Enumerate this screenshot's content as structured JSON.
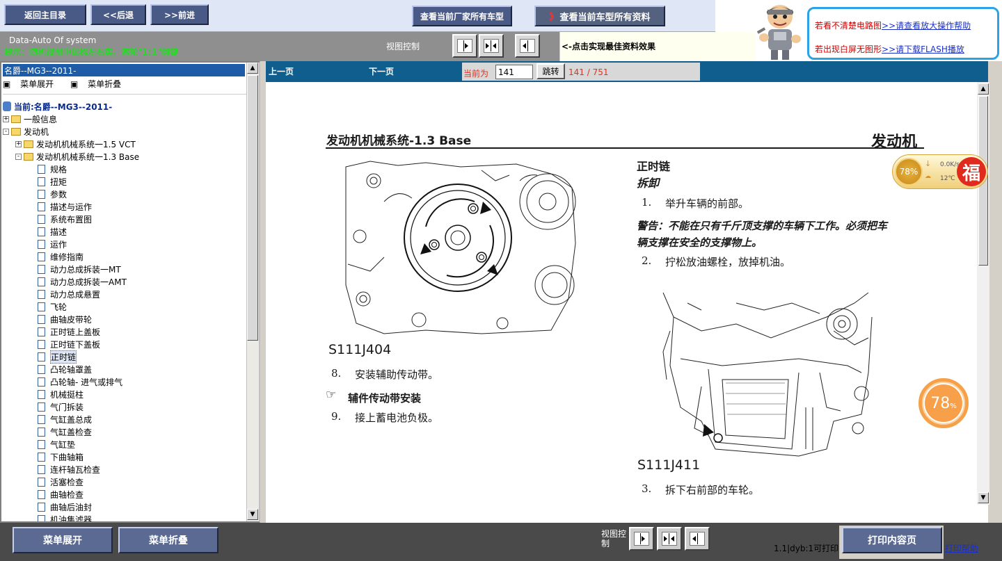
{
  "topbar": {
    "back_main": "返回主目录",
    "back": "<<后退",
    "forward": ">>前进",
    "maker_models": "查看当前厂家所有车型",
    "all_data": "查看当前车型所有资料",
    "all_data_arrow": "》"
  },
  "help": {
    "line1_text": "若看不清楚电路图",
    "line1_link": ">>请查看放大操作帮助",
    "line2_text": "若出现白屏无图形",
    "line2_link": ">>请下载FLASH播放"
  },
  "subbar": {
    "system": "Data-Auto Of system",
    "note": "提示：随机视图中鼠标左右实，滚轮\"1:1\"翻键",
    "view_control": "视图控制",
    "tip": "<-点击实现最佳资料效果"
  },
  "left": {
    "car_title": "名爵--MG3--2011-",
    "expand": "菜单展开",
    "collapse": "菜单折叠",
    "tree": [
      {
        "label": "当前:名爵--MG3--2011-",
        "type": "current",
        "level": 0
      },
      {
        "label": "一般信息",
        "type": "folder",
        "sign": "+",
        "level": 0
      },
      {
        "label": "发动机",
        "type": "folder",
        "sign": "-",
        "level": 0
      },
      {
        "label": "发动机机械系统一1.5 VCT",
        "type": "folder",
        "sign": "+",
        "level": 1
      },
      {
        "label": "发动机机械系统一1.3 Base",
        "type": "folder",
        "sign": "-",
        "level": 1
      },
      {
        "label": "规格",
        "type": "doc",
        "level": 2
      },
      {
        "label": "扭矩",
        "type": "doc",
        "level": 2
      },
      {
        "label": "参数",
        "type": "doc",
        "level": 2
      },
      {
        "label": "描述与运作",
        "type": "doc",
        "level": 2
      },
      {
        "label": "系统布置图",
        "type": "doc",
        "level": 2
      },
      {
        "label": "描述",
        "type": "doc",
        "level": 2
      },
      {
        "label": "运作",
        "type": "doc",
        "level": 2
      },
      {
        "label": "维修指南",
        "type": "doc",
        "level": 2
      },
      {
        "label": "动力总成拆装一MT",
        "type": "doc",
        "level": 2
      },
      {
        "label": "动力总成拆装一AMT",
        "type": "doc",
        "level": 2
      },
      {
        "label": "动力总成悬置",
        "type": "doc",
        "level": 2
      },
      {
        "label": "飞轮",
        "type": "doc",
        "level": 2
      },
      {
        "label": "曲轴皮带轮",
        "type": "doc",
        "level": 2
      },
      {
        "label": "正时链上盖板",
        "type": "doc",
        "level": 2
      },
      {
        "label": "正时链下盖板",
        "type": "doc",
        "level": 2
      },
      {
        "label": "正时链",
        "type": "doc",
        "level": 2,
        "selected": true
      },
      {
        "label": "凸轮轴罩盖",
        "type": "doc",
        "level": 2
      },
      {
        "label": "凸轮轴- 进气或排气",
        "type": "doc",
        "level": 2
      },
      {
        "label": "机械挺柱",
        "type": "doc",
        "level": 2
      },
      {
        "label": "气门拆装",
        "type": "doc",
        "level": 2
      },
      {
        "label": "气缸盖总成",
        "type": "doc",
        "level": 2
      },
      {
        "label": "气缸盖检查",
        "type": "doc",
        "level": 2
      },
      {
        "label": "气缸垫",
        "type": "doc",
        "level": 2
      },
      {
        "label": "下曲轴箱",
        "type": "doc",
        "level": 2
      },
      {
        "label": "连杆轴瓦检查",
        "type": "doc",
        "level": 2
      },
      {
        "label": "活塞检查",
        "type": "doc",
        "level": 2
      },
      {
        "label": "曲轴检查",
        "type": "doc",
        "level": 2
      },
      {
        "label": "曲轴后油封",
        "type": "doc",
        "level": 2
      },
      {
        "label": "机油集滤器",
        "type": "doc",
        "level": 2
      }
    ]
  },
  "pager": {
    "prev": "上一页",
    "next": "下一页",
    "current_label": "当前为",
    "page_value": "141",
    "jump": "跳转",
    "count": "141 / 751"
  },
  "doc": {
    "header_left": "发动机机械系统-1.3 Base",
    "header_right": "发动机",
    "fig1": "S111J404",
    "step8": "8.",
    "step8_text": "安装辅助传动带。",
    "sub_heading": "辅件传动带安装",
    "step9": "9.",
    "step9_text": "接上蓄电池负极。",
    "section": "正时链",
    "removal": "拆卸",
    "step1": "1.",
    "step1_text": "举升车辆的前部。",
    "warning_1": "警告：不能在只有千斤顶支撑的车辆下工作。必须把车",
    "warning_2": "辆支撑在安全的支撑物上。",
    "step2": "2.",
    "step2_text": "拧松放油螺栓，放掉机油。",
    "fig2": "S111J411",
    "step3": "3.",
    "step3_text": "拆下右前部的车轮。"
  },
  "widget": {
    "percent": "78%",
    "speed": "0.0K/s",
    "temp": "12℃",
    "fu": "福",
    "big_value": "78",
    "big_unit": "%"
  },
  "bottom": {
    "expand": "菜单展开",
    "collapse": "菜单折叠",
    "view_control": "视图控制",
    "print_info": "1.1|dyb:1可打印",
    "print_page": "打印内容页",
    "print_help": "打印帮助"
  }
}
